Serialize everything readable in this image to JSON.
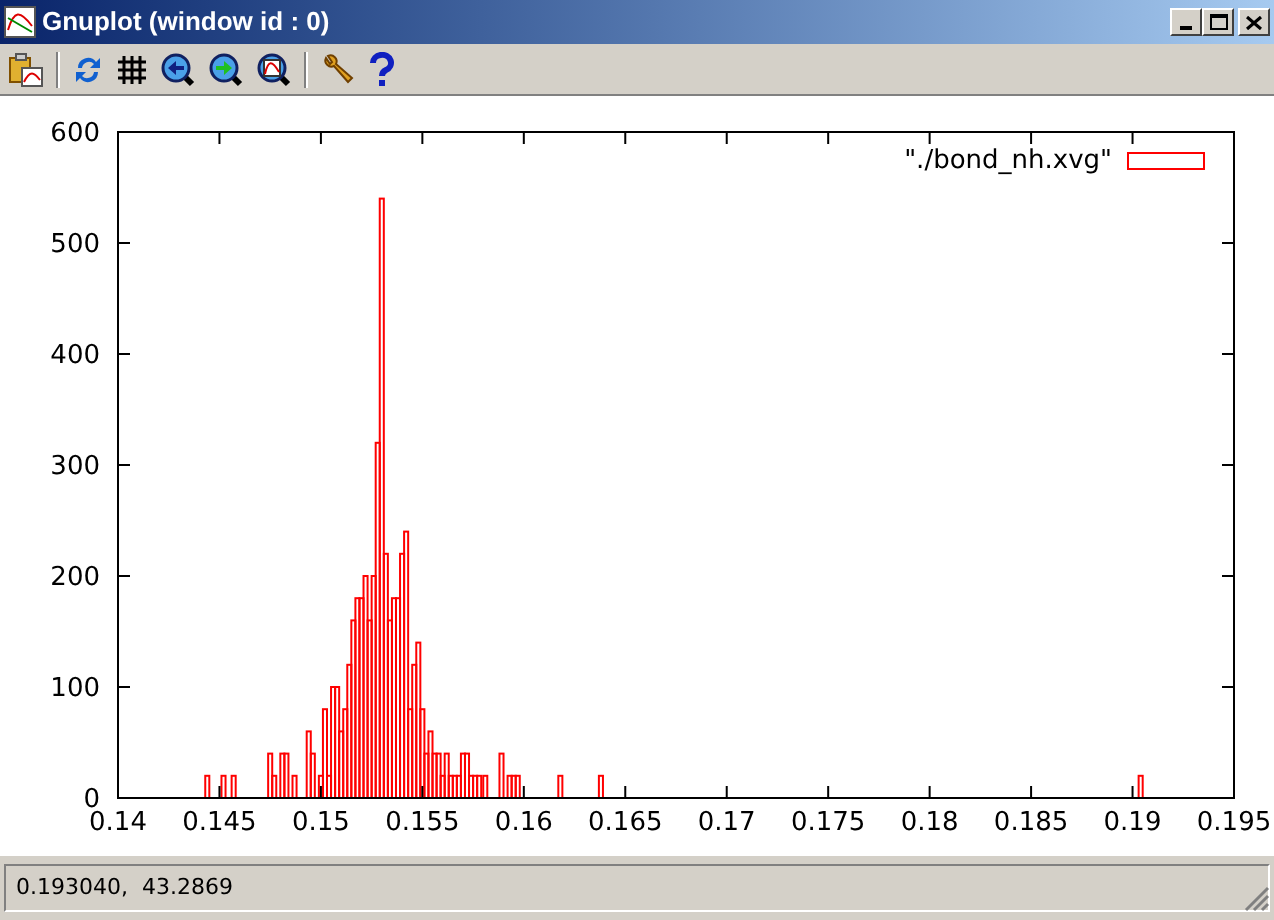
{
  "window": {
    "title": "Gnuplot (window id : 0)"
  },
  "plot": {
    "chart_data": {
      "type": "bar",
      "x": [
        0.1443,
        0.1451,
        0.1456,
        0.1474,
        0.1476,
        0.148,
        0.1482,
        0.1486,
        0.1493,
        0.1495,
        0.1499,
        0.1501,
        0.1503,
        0.1505,
        0.1507,
        0.1509,
        0.1511,
        0.1513,
        0.1515,
        0.1517,
        0.1519,
        0.1521,
        0.1523,
        0.1525,
        0.1527,
        0.1529,
        0.1531,
        0.1533,
        0.1535,
        0.1537,
        0.1539,
        0.1541,
        0.1543,
        0.1545,
        0.1547,
        0.1549,
        0.1551,
        0.1553,
        0.1555,
        0.1557,
        0.1559,
        0.1561,
        0.1563,
        0.1565,
        0.1567,
        0.1569,
        0.1571,
        0.1573,
        0.1575,
        0.1577,
        0.158,
        0.1588,
        0.1592,
        0.1594,
        0.1596,
        0.1617,
        0.1637,
        0.1903
      ],
      "series": [
        {
          "name": "\"./bond_nh.xvg\"",
          "color": "#ff0000",
          "values": [
            20,
            20,
            20,
            40,
            20,
            40,
            40,
            20,
            60,
            40,
            20,
            80,
            20,
            100,
            100,
            60,
            80,
            120,
            160,
            180,
            180,
            200,
            160,
            200,
            320,
            540,
            220,
            160,
            180,
            180,
            220,
            240,
            80,
            120,
            140,
            80,
            40,
            60,
            40,
            40,
            20,
            40,
            20,
            20,
            20,
            40,
            40,
            20,
            20,
            20,
            20,
            40,
            20,
            20,
            20,
            20,
            20,
            20
          ]
        }
      ],
      "xlim": [
        0.14,
        0.195
      ],
      "ylim": [
        0,
        600
      ],
      "xticks": [
        {
          "value": 0.14,
          "label": "0.14"
        },
        {
          "value": 0.145,
          "label": "0.145"
        },
        {
          "value": 0.15,
          "label": "0.15"
        },
        {
          "value": 0.155,
          "label": "0.155"
        },
        {
          "value": 0.16,
          "label": "0.16"
        },
        {
          "value": 0.165,
          "label": "0.165"
        },
        {
          "value": 0.17,
          "label": "0.17"
        },
        {
          "value": 0.175,
          "label": "0.175"
        },
        {
          "value": 0.18,
          "label": "0.18"
        },
        {
          "value": 0.185,
          "label": "0.185"
        },
        {
          "value": 0.19,
          "label": "0.19"
        },
        {
          "value": 0.195,
          "label": "0.195"
        }
      ],
      "yticks": [
        0,
        100,
        200,
        300,
        400,
        500,
        600
      ]
    }
  },
  "status_bar": {
    "text": "0.193040,  43.2869"
  }
}
